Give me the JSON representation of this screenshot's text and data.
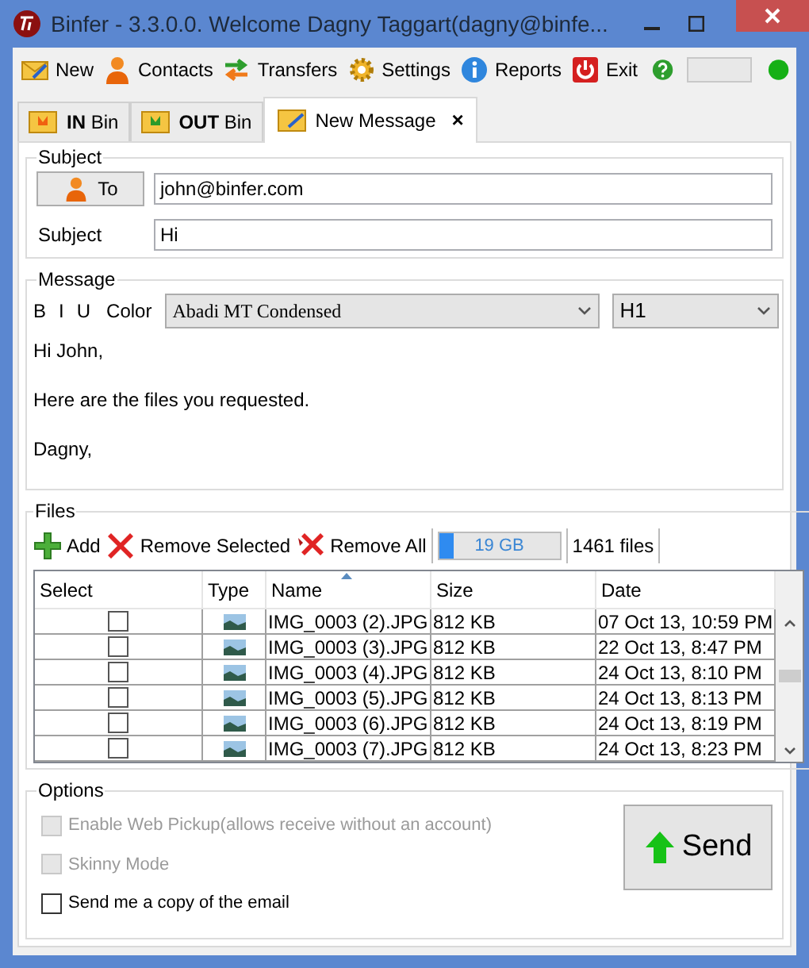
{
  "window": {
    "title": "Binfer - 3.3.0.0. Welcome Dagny Taggart(dagny@binfe..."
  },
  "toolbar": [
    {
      "label": "New"
    },
    {
      "label": "Contacts"
    },
    {
      "label": "Transfers"
    },
    {
      "label": "Settings"
    },
    {
      "label": "Reports"
    },
    {
      "label": "Exit"
    }
  ],
  "tabs": [
    {
      "bold": "IN",
      "label": "Bin",
      "selected": false
    },
    {
      "bold": "OUT",
      "label": "Bin",
      "selected": false
    },
    {
      "label": "New Message",
      "selected": true,
      "close": "×"
    }
  ],
  "subject_group": {
    "title": "Subject",
    "to_button": "To",
    "to_value": "john@binfer.com",
    "subject_label": "Subject",
    "subject_value": "Hi"
  },
  "message_group": {
    "title": "Message",
    "format_buttons": [
      "B",
      "I",
      "U"
    ],
    "color_label": "Color",
    "font": "Abadi MT Condensed",
    "heading": "H1",
    "body": [
      "Hi John,",
      "Here are the files you requested.",
      "Dagny,"
    ]
  },
  "files_group": {
    "title": "Files",
    "actions": [
      {
        "label": "Add"
      },
      {
        "label": "Remove Selected"
      },
      {
        "label": "Remove All"
      }
    ],
    "usage": {
      "label": "19 GB",
      "level": 0.12
    },
    "count": "1461 files",
    "table": {
      "columns": [
        "Select",
        "Type",
        "Name",
        "Size",
        "Date"
      ],
      "rows": [
        {
          "checked": false,
          "name": "IMG_0003 (2).JPG",
          "size": "812 KB",
          "date": "07 Oct 13, 10:59 PM"
        },
        {
          "checked": false,
          "name": "IMG_0003 (3).JPG",
          "size": "812 KB",
          "date": "22 Oct 13, 8:47 PM"
        },
        {
          "checked": false,
          "name": "IMG_0003 (4).JPG",
          "size": "812 KB",
          "date": "24 Oct 13, 8:10 PM"
        },
        {
          "checked": false,
          "name": "IMG_0003 (5).JPG",
          "size": "812 KB",
          "date": "24 Oct 13, 8:13 PM"
        },
        {
          "checked": false,
          "name": "IMG_0003 (6).JPG",
          "size": "812 KB",
          "date": "24 Oct 13, 8:19 PM"
        },
        {
          "checked": false,
          "name": "IMG_0003 (7).JPG",
          "size": "812 KB",
          "date": "24 Oct 13, 8:23 PM"
        }
      ]
    }
  },
  "options_group": {
    "title": "Options",
    "options": [
      {
        "label": "Enable Web Pickup(allows receive without an account)",
        "checked": false,
        "disabled": true
      },
      {
        "label": "Skinny Mode",
        "checked": false,
        "disabled": true
      },
      {
        "label": "Send me a copy of the email",
        "checked": false,
        "disabled": false
      }
    ],
    "send_button": "Send"
  }
}
